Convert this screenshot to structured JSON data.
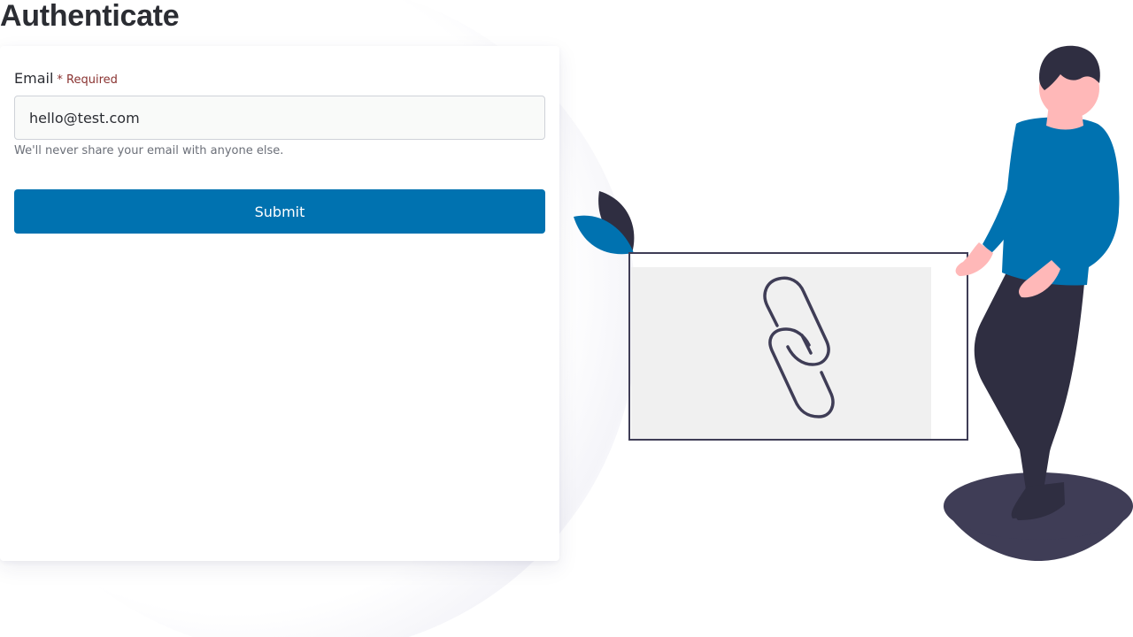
{
  "page": {
    "title": "Authenticate"
  },
  "form": {
    "email_label": "Email",
    "required_label": "* Required",
    "email_value": "hello@test.com",
    "email_help": "We'll never share your email with anyone else.",
    "submit_label": "Submit"
  },
  "colors": {
    "accent": "#0072b0",
    "dark": "#2f2e41",
    "required": "#8a3331"
  },
  "illustration": {
    "name": "link-sharing-illustration",
    "icon": "link-chain-icon"
  }
}
